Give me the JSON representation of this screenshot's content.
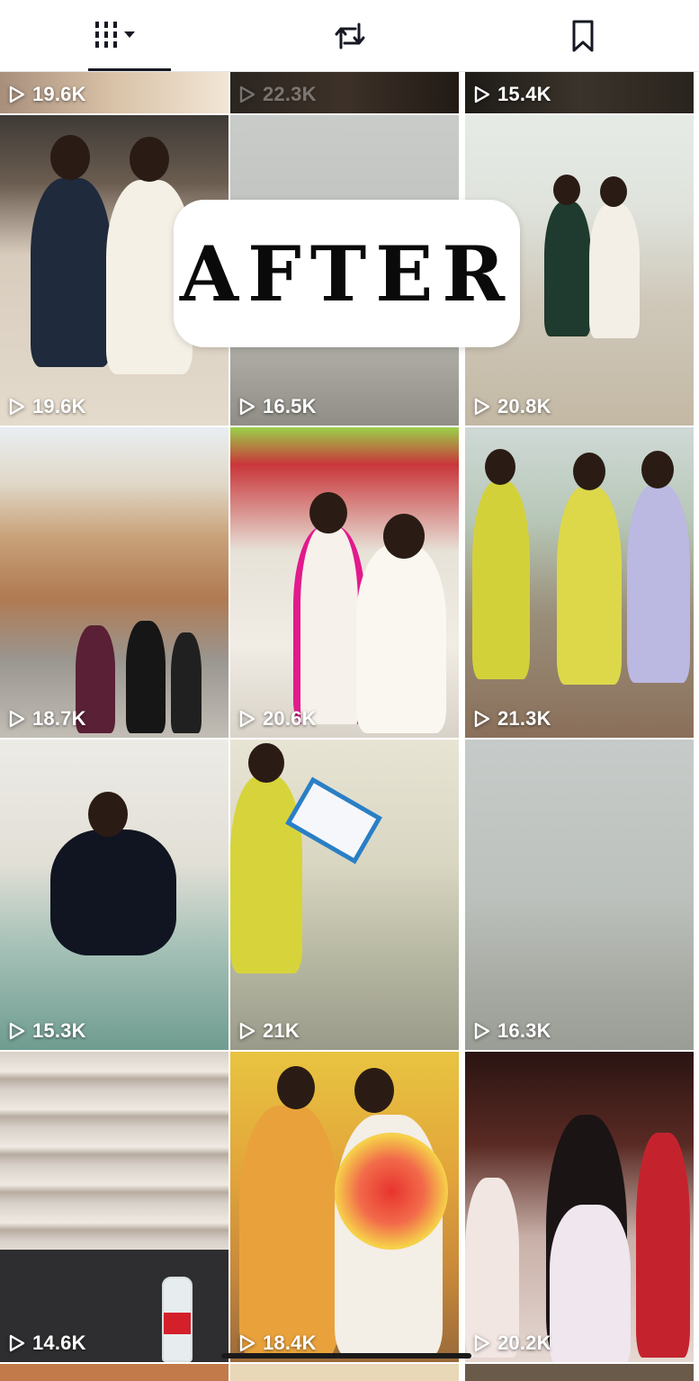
{
  "tabs": [
    {
      "name": "videos",
      "icon": "grid-filter-icon",
      "active": true
    },
    {
      "name": "reposts",
      "icon": "repost-icon",
      "active": false
    },
    {
      "name": "favorites",
      "icon": "bookmark-icon",
      "active": false
    }
  ],
  "overlay": {
    "text": "AFTER"
  },
  "videos": [
    {
      "views": "19.6K"
    },
    {
      "views": "22.3K"
    },
    {
      "views": "15.4K"
    },
    {
      "views": "19.6K"
    },
    {
      "views": "16.5K"
    },
    {
      "views": "20.8K"
    },
    {
      "views": "18.7K"
    },
    {
      "views": "20.6K"
    },
    {
      "views": "21.3K"
    },
    {
      "views": "15.3K"
    },
    {
      "views": "21K"
    },
    {
      "views": "16.3K"
    },
    {
      "views": "14.6K"
    },
    {
      "views": "18.4K"
    },
    {
      "views": "20.2K"
    }
  ],
  "colors": {
    "text": "#161823",
    "underline": "#161823",
    "overlay_bg": "#ffffff"
  }
}
